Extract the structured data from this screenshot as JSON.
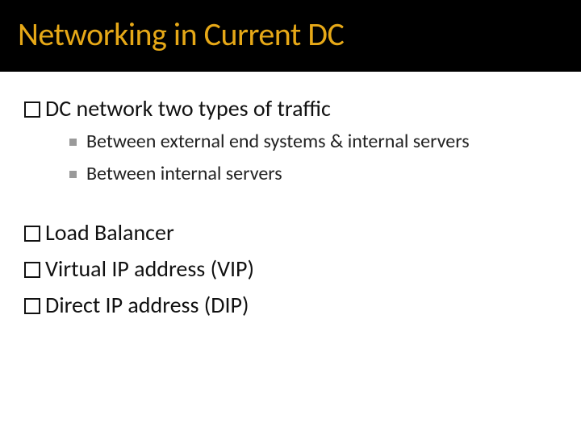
{
  "title": "Networking in Current DC",
  "items": [
    {
      "text": "DC network two types of traffic",
      "children": [
        "Between external end systems & internal servers",
        "Between internal servers"
      ]
    },
    {
      "text": "Load Balancer"
    },
    {
      "text": "Virtual IP address (VIP)"
    },
    {
      "text": "Direct IP address (DIP)"
    }
  ]
}
